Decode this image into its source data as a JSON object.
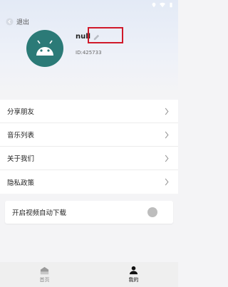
{
  "header": {
    "back_label": "退出",
    "username": "null",
    "user_id": "ID:425733"
  },
  "menu": {
    "items": [
      {
        "label": "分享朋友"
      },
      {
        "label": "音乐列表"
      },
      {
        "label": "关于我们"
      },
      {
        "label": "隐私政策"
      }
    ]
  },
  "settings": {
    "auto_download_label": "开启视频自动下载",
    "auto_download_enabled": false
  },
  "bottom_nav": {
    "home_label": "首页",
    "mine_label": "我的",
    "active": "mine"
  },
  "colors": {
    "avatar_bg": "#2b7a77",
    "highlight": "#d0192a"
  }
}
